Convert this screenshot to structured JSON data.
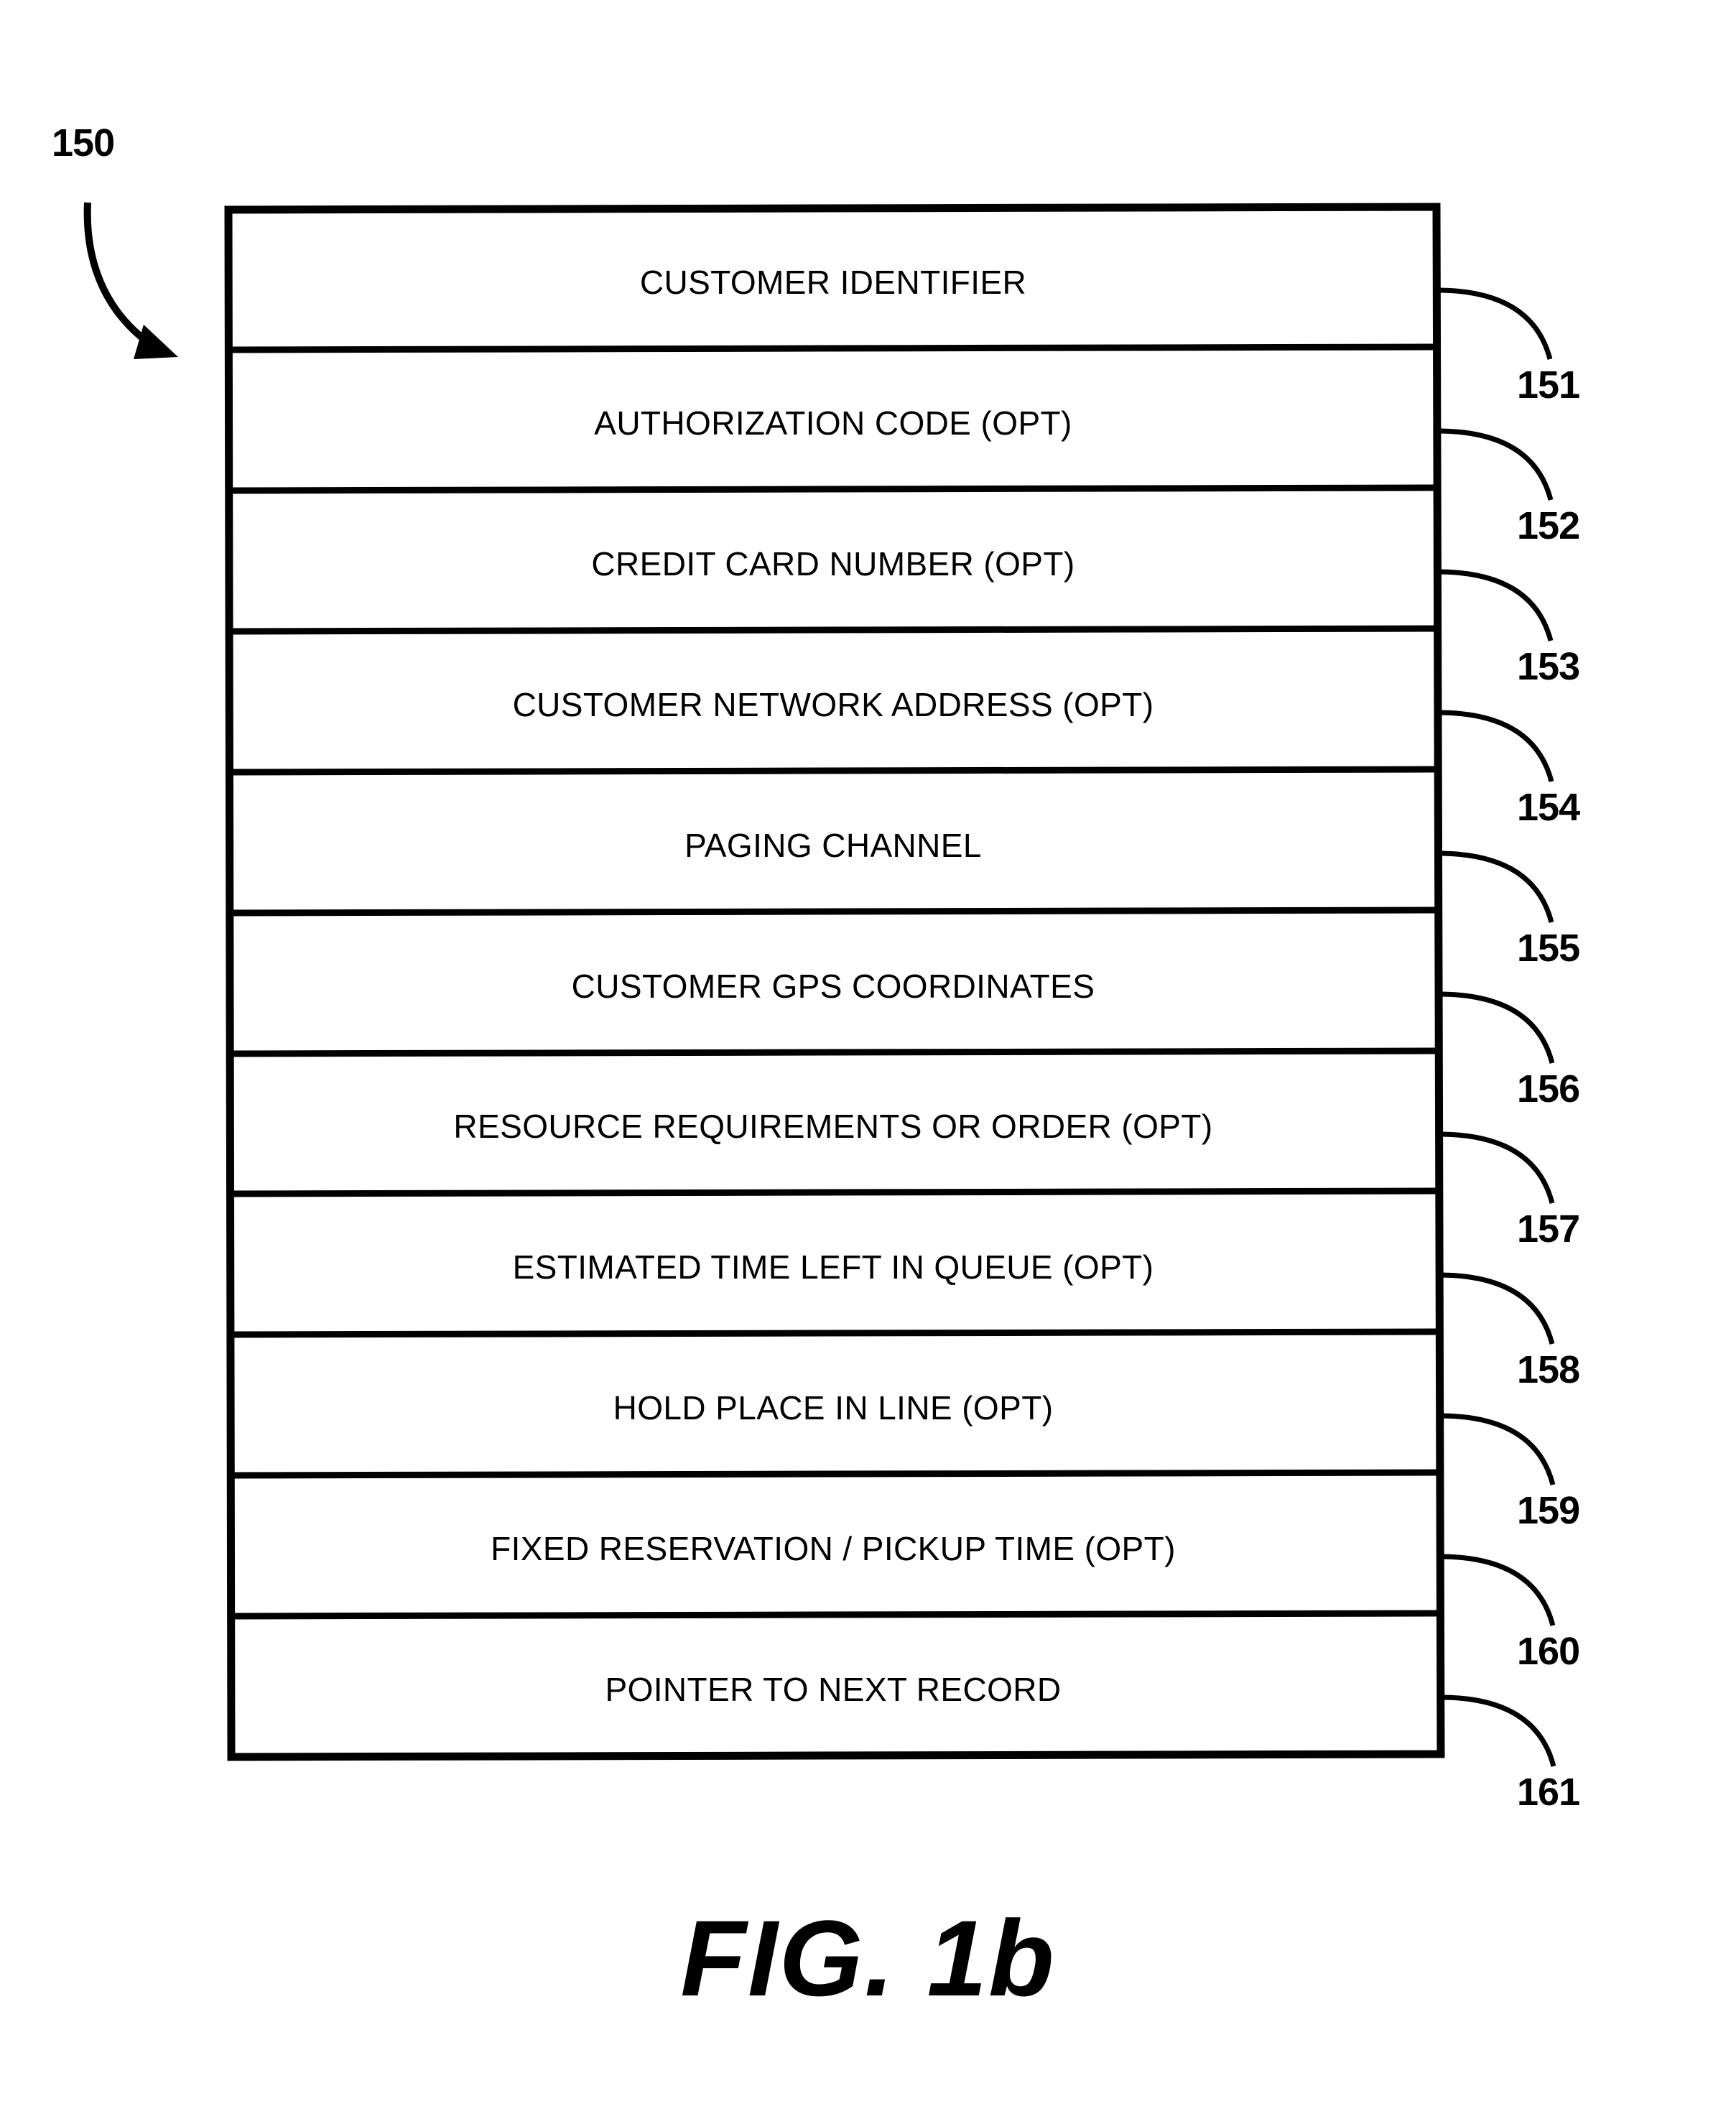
{
  "figure": {
    "caption": "FIG. 1b",
    "diagram_label": "150",
    "record_rows": [
      {
        "label": "CUSTOMER IDENTIFIER",
        "ref": "151"
      },
      {
        "label": "AUTHORIZATION CODE (OPT)",
        "ref": "152"
      },
      {
        "label": "CREDIT CARD NUMBER (OPT)",
        "ref": "153"
      },
      {
        "label": "CUSTOMER NETWORK ADDRESS (OPT)",
        "ref": "154"
      },
      {
        "label": "PAGING CHANNEL",
        "ref": "155"
      },
      {
        "label": "CUSTOMER GPS COORDINATES",
        "ref": "156"
      },
      {
        "label": "RESOURCE REQUIREMENTS OR ORDER (OPT)",
        "ref": "157"
      },
      {
        "label": "ESTIMATED TIME LEFT IN QUEUE (OPT)",
        "ref": "158"
      },
      {
        "label": "HOLD PLACE IN LINE (OPT)",
        "ref": "159"
      },
      {
        "label": "FIXED RESERVATION / PICKUP TIME (OPT)",
        "ref": "160"
      },
      {
        "label": "POINTER TO NEXT RECORD",
        "ref": "161"
      }
    ],
    "colors": {
      "ink": "#000000",
      "background": "#ffffff"
    }
  }
}
